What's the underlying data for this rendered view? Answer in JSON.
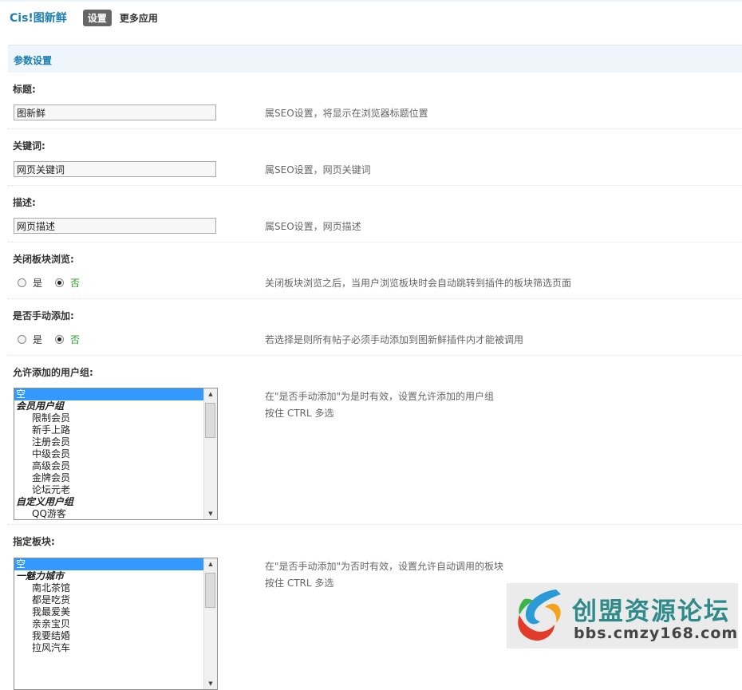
{
  "header": {
    "app_title": "Cis!图新鲜",
    "tabs": [
      "设置",
      "更多应用"
    ]
  },
  "section": {
    "title": "参数设置"
  },
  "fields": {
    "title": {
      "label": "标题:",
      "value": "图新鲜",
      "tip": "属SEO设置，将显示在浏览器标题位置"
    },
    "keywords": {
      "label": "关键词:",
      "value": "网页关键词",
      "tip": "属SEO设置，网页关键词"
    },
    "description": {
      "label": "描述:",
      "value": "网页描述",
      "tip": "属SEO设置，网页描述"
    },
    "close_forum_browse": {
      "label": "关闭板块浏览:",
      "option_yes": "是",
      "option_no": "否",
      "selected": "否",
      "tip": "关闭板块浏览之后，当用户浏览板块时会自动跳转到插件的板块筛选页面"
    },
    "manual_add": {
      "label": "是否手动添加:",
      "option_yes": "是",
      "option_no": "否",
      "selected": "否",
      "tip": "若选择是则所有帖子必须手动添加到图新鲜插件内才能被调用"
    },
    "allowed_groups": {
      "label": "允许添加的用户组:",
      "tip1": "在\"是否手动添加\"为是时有效，设置允许添加的用户组",
      "tip2": "按住 CTRL 多选",
      "options": [
        {
          "text": "空",
          "kind": "sel"
        },
        {
          "text": "会员用户组",
          "kind": "group"
        },
        {
          "text": "限制会员",
          "kind": "sub"
        },
        {
          "text": "新手上路",
          "kind": "sub"
        },
        {
          "text": "注册会员",
          "kind": "sub"
        },
        {
          "text": "中级会员",
          "kind": "sub"
        },
        {
          "text": "高级会员",
          "kind": "sub"
        },
        {
          "text": "金牌会员",
          "kind": "sub"
        },
        {
          "text": "论坛元老",
          "kind": "sub"
        },
        {
          "text": "自定义用户组",
          "kind": "group"
        },
        {
          "text": "QQ游客",
          "kind": "sub"
        }
      ]
    },
    "forums": {
      "label": "指定板块:",
      "tip1": "在\"是否手动添加\"为否时有效，设置允许自动调用的板块",
      "tip2": "按住 CTRL 多选",
      "options": [
        {
          "text": "空",
          "kind": "sel"
        },
        {
          "text": "一魅力城市",
          "kind": "group"
        },
        {
          "text": "南北茶馆",
          "kind": "sub"
        },
        {
          "text": "都是吃货",
          "kind": "sub"
        },
        {
          "text": "我最爱美",
          "kind": "sub"
        },
        {
          "text": "亲亲宝贝",
          "kind": "sub"
        },
        {
          "text": "我要结婚",
          "kind": "sub"
        },
        {
          "text": "拉风汽车",
          "kind": "sub"
        }
      ]
    }
  },
  "watermark": {
    "text": "创盟资源论坛",
    "url": "bbs.cmzy168.com"
  }
}
